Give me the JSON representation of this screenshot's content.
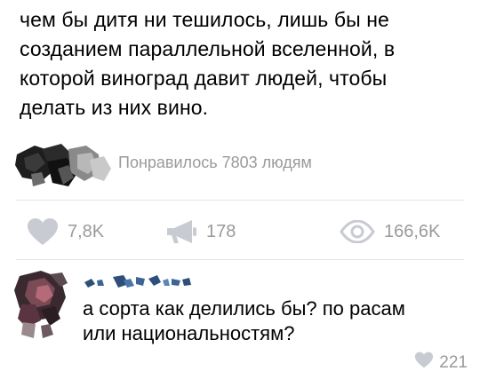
{
  "post": {
    "text_lines": [
      "чем бы дитя ни тешилось, лишь бы не",
      "созданием параллельной вселенной, в",
      "которой виноград давит людей, чтобы",
      "делать из них вино."
    ],
    "likers_text": "Понравилось 7803 людям"
  },
  "actions": {
    "likes": {
      "icon": "heart-icon",
      "count": "7,8K"
    },
    "reposts": {
      "icon": "megaphone-icon",
      "count": "178"
    },
    "views": {
      "icon": "eye-icon",
      "count": "166,6K"
    }
  },
  "comment": {
    "text_lines": [
      "а сорта как делились бы? по расам",
      "или национальностям?"
    ],
    "likes": {
      "icon": "heart-icon",
      "count": "221"
    }
  },
  "colors": {
    "muted": "#9a9a9a",
    "divider": "#e3e4e8",
    "text": "#000000"
  }
}
